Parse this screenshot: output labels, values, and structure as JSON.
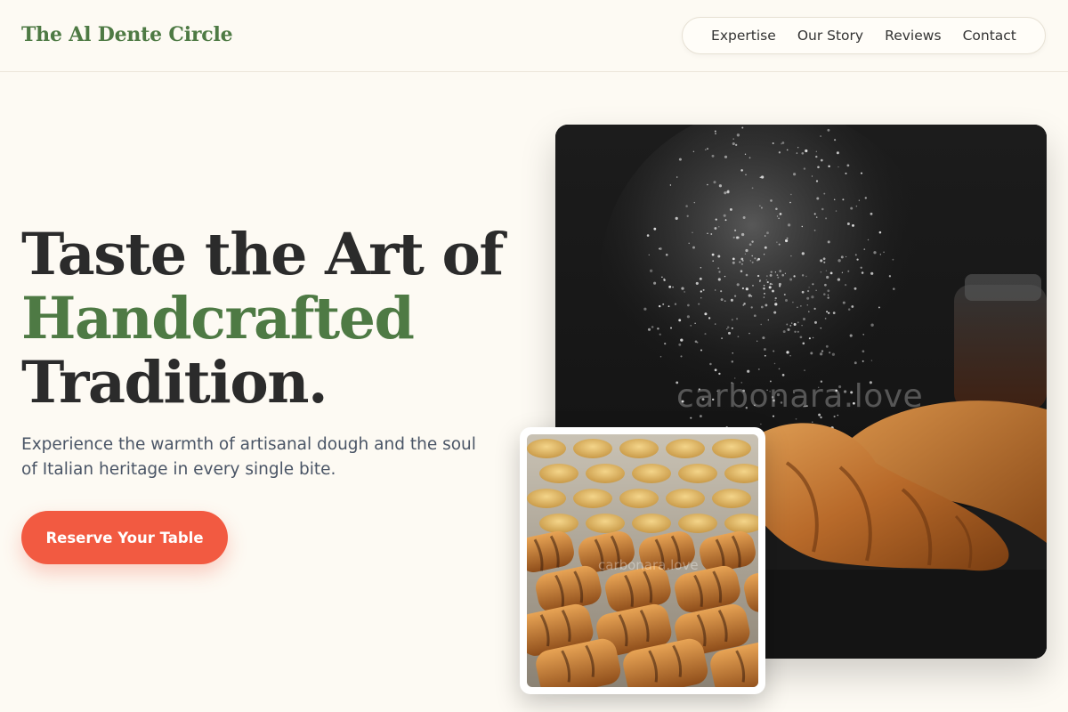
{
  "brand": {
    "name": "The Al Dente Circle"
  },
  "nav": {
    "items": [
      {
        "label": "Expertise"
      },
      {
        "label": "Our Story"
      },
      {
        "label": "Reviews"
      },
      {
        "label": "Contact"
      }
    ]
  },
  "hero": {
    "headline_line1": "Taste the Art of",
    "headline_line2": "Handcrafted",
    "headline_line3": "Tradition.",
    "subtitle": "Experience the warmth of artisanal dough and the soul of Italian heritage in every single bite.",
    "cta_label": "Reserve Your Table"
  },
  "images": {
    "main_watermark": "carbonara.love",
    "inset_watermark": "carbonara.love"
  },
  "colors": {
    "background": "#fdfaf3",
    "brand_green": "#4e7a44",
    "accent_coral": "#f25a41",
    "text_dark": "#2b2b2b",
    "text_muted": "#4a5566"
  }
}
